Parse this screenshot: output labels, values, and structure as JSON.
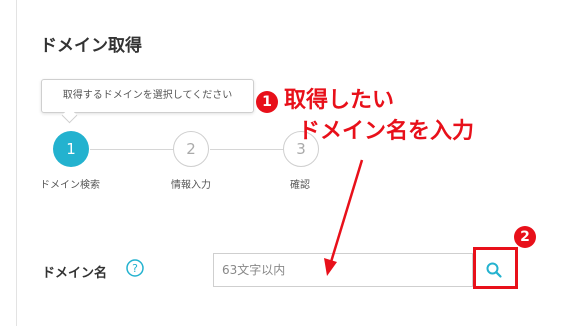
{
  "page": {
    "title": "ドメイン取得",
    "tooltip": "取得するドメインを選択してください"
  },
  "steps": [
    {
      "number": "1",
      "label": "ドメイン検索",
      "state": "active"
    },
    {
      "number": "2",
      "label": "情報入力",
      "state": "inactive"
    },
    {
      "number": "3",
      "label": "確認",
      "state": "inactive"
    }
  ],
  "form": {
    "label": "ドメイン名",
    "placeholder": "63文字以内",
    "value": "",
    "help_icon": "question-circle-icon",
    "search_icon": "magnifier-icon"
  },
  "annotations": {
    "badge1": "1",
    "badge2": "2",
    "callout_line1": "取得したい",
    "callout_line2": "ドメイン名を入力"
  },
  "colors": {
    "accent": "#23b2cf",
    "annotation": "#e8101a",
    "border": "#cfcfcf"
  }
}
